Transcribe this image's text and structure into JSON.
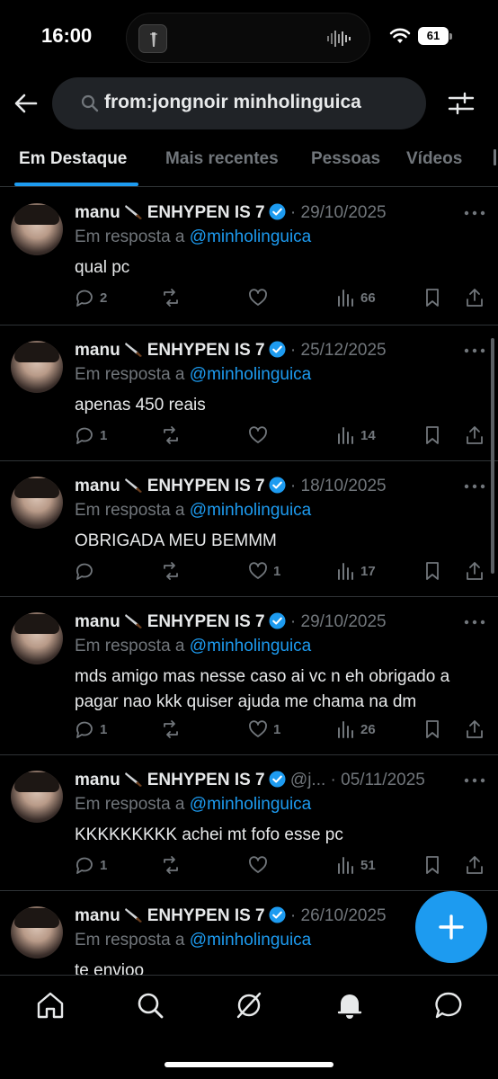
{
  "status_bar": {
    "time": "16:00",
    "battery": "61"
  },
  "search": {
    "query": "from:jongnoir minholinguica"
  },
  "tabs": [
    {
      "label": "Em Destaque",
      "active": true
    },
    {
      "label": "Mais recentes",
      "active": false
    },
    {
      "label": "Pessoas",
      "active": false
    },
    {
      "label": "Vídeos",
      "active": false
    }
  ],
  "tweets": [
    {
      "name": "manu",
      "name_suffix": "ENHYPEN IS 7",
      "handle": "",
      "date": "29/10/2025",
      "reply_prefix": "Em resposta a",
      "reply_to": "@minholinguica",
      "text": "qual pc",
      "replies": "2",
      "retweets": "",
      "likes": "",
      "views": "66"
    },
    {
      "name": "manu",
      "name_suffix": "ENHYPEN IS 7",
      "handle": "",
      "date": "25/12/2025",
      "reply_prefix": "Em resposta a",
      "reply_to": "@minholinguica",
      "text": "apenas 450 reais",
      "replies": "1",
      "retweets": "",
      "likes": "",
      "views": "14"
    },
    {
      "name": "manu",
      "name_suffix": "ENHYPEN IS 7",
      "handle": "",
      "date": "18/10/2025",
      "reply_prefix": "Em resposta a",
      "reply_to": "@minholinguica",
      "text": "OBRIGADA MEU BEMMM",
      "replies": "",
      "retweets": "",
      "likes": "1",
      "views": "17"
    },
    {
      "name": "manu",
      "name_suffix": "ENHYPEN IS 7",
      "handle": "",
      "date": "29/10/2025",
      "reply_prefix": "Em resposta a",
      "reply_to": "@minholinguica",
      "text": "mds amigo mas nesse caso ai vc n eh obrigado a pagar nao kkk quiser ajuda me chama na dm",
      "replies": "1",
      "retweets": "",
      "likes": "1",
      "views": "26"
    },
    {
      "name": "manu",
      "name_suffix": "ENHYPEN IS 7",
      "handle": "@j...",
      "date": "05/11/2025",
      "reply_prefix": "Em resposta a",
      "reply_to": "@minholinguica",
      "text": "KKKKKKKKK achei mt fofo esse pc",
      "replies": "1",
      "retweets": "",
      "likes": "",
      "views": "51"
    },
    {
      "name": "manu",
      "name_suffix": "ENHYPEN IS 7",
      "handle": "",
      "date": "26/10/2025",
      "reply_prefix": "Em resposta a",
      "reply_to": "@minholinguica",
      "text": "te envioo",
      "replies": "",
      "retweets": "",
      "likes": "",
      "views": ""
    }
  ],
  "colors": {
    "accent": "#1d9bf0",
    "muted": "#71767b",
    "text": "#e7e9ea",
    "divider": "#2f3336"
  },
  "bottom_nav": [
    "home-icon",
    "search-icon",
    "grok-icon",
    "notifications-icon",
    "messages-icon"
  ]
}
